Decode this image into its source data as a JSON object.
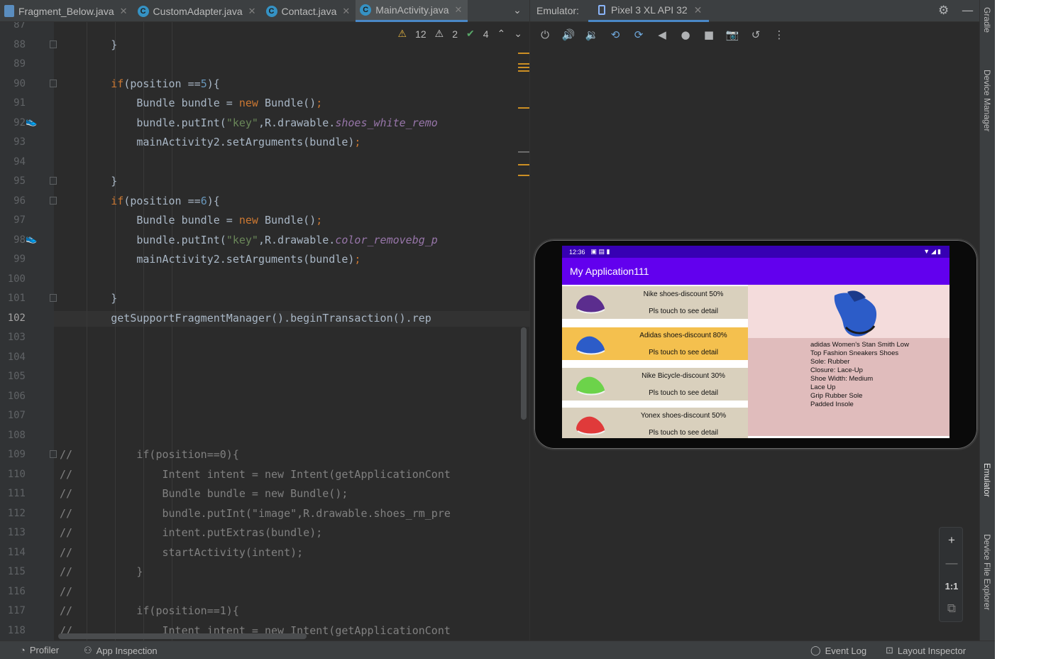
{
  "editor_tabs": [
    {
      "label": "Fragment_Below.java",
      "icon": "java-file-icon",
      "active": false
    },
    {
      "label": "CustomAdapter.java",
      "icon": "java-class-icon",
      "active": false
    },
    {
      "label": "Contact.java",
      "icon": "java-class-icon",
      "active": false
    },
    {
      "label": "MainActivity.java",
      "icon": "java-class-icon",
      "active": true
    }
  ],
  "inspections": {
    "warnings": "12",
    "weak_warnings": "2",
    "typos": "4"
  },
  "code_lines": [
    {
      "n": "87",
      "text": ""
    },
    {
      "n": "88",
      "text": "        }"
    },
    {
      "n": "89",
      "text": ""
    },
    {
      "n": "90",
      "text": "        if(position ==5){"
    },
    {
      "n": "91",
      "text": "            Bundle bundle = new Bundle();"
    },
    {
      "n": "92",
      "text": "            bundle.putInt(\"key\",R.drawable.shoes_white_remo"
    },
    {
      "n": "93",
      "text": "            mainActivity2.setArguments(bundle);"
    },
    {
      "n": "94",
      "text": ""
    },
    {
      "n": "95",
      "text": "        }"
    },
    {
      "n": "96",
      "text": "        if(position ==6){"
    },
    {
      "n": "97",
      "text": "            Bundle bundle = new Bundle();"
    },
    {
      "n": "98",
      "text": "            bundle.putInt(\"key\",R.drawable.color_removebg_p"
    },
    {
      "n": "99",
      "text": "            mainActivity2.setArguments(bundle);"
    },
    {
      "n": "100",
      "text": ""
    },
    {
      "n": "101",
      "text": "        }"
    },
    {
      "n": "102",
      "text": "        getSupportFragmentManager().beginTransaction().rep"
    },
    {
      "n": "103",
      "text": ""
    },
    {
      "n": "104",
      "text": ""
    },
    {
      "n": "105",
      "text": ""
    },
    {
      "n": "106",
      "text": ""
    },
    {
      "n": "107",
      "text": ""
    },
    {
      "n": "108",
      "text": ""
    },
    {
      "n": "109",
      "text": "//          if(position==0){"
    },
    {
      "n": "110",
      "text": "//              Intent intent = new Intent(getApplicationCont"
    },
    {
      "n": "111",
      "text": "//              Bundle bundle = new Bundle();"
    },
    {
      "n": "112",
      "text": "//              bundle.putInt(\"image\",R.drawable.shoes_rm_pre"
    },
    {
      "n": "113",
      "text": "//              intent.putExtras(bundle);"
    },
    {
      "n": "114",
      "text": "//              startActivity(intent);"
    },
    {
      "n": "115",
      "text": "//          }"
    },
    {
      "n": "116",
      "text": "//"
    },
    {
      "n": "117",
      "text": "//          if(position==1){"
    },
    {
      "n": "118",
      "text": "//              Intent intent = new Intent(getApplicationCont"
    }
  ],
  "current_line": "102",
  "emulator": {
    "label": "Emulator:",
    "device_tab": "Pixel 3 XL API 32",
    "toolbar_icons": [
      "power-icon",
      "volume-up-icon",
      "volume-down-icon",
      "rotate-left-icon",
      "rotate-right-icon",
      "back-icon",
      "home-icon",
      "overview-icon",
      "screenshot-icon",
      "snapshot-icon",
      "more-icon"
    ]
  },
  "phone": {
    "time": "12:36",
    "app_title": "My Application111",
    "rows": [
      {
        "title": "Nike shoes-discount 50%",
        "subtitle": "Pls touch to see detail",
        "bg": "#d9d0bd",
        "shoe_color": "#5b2d8e"
      },
      {
        "title": "Adidas shoes-discount 80%",
        "subtitle": "Pls touch to see detail",
        "bg": "#f4c04e",
        "shoe_color": "#2c5cc8"
      },
      {
        "title": "Nike Bicycle-discount 30%",
        "subtitle": "Pls touch to see detail",
        "bg": "#d9d0bd",
        "shoe_color": "#6cd34a"
      },
      {
        "title": "Yonex shoes-discount 50%",
        "subtitle": "Pls touch to see detail",
        "bg": "#d9d0bd",
        "shoe_color": "#e03a3a"
      }
    ],
    "detail_lines": [
      "adidas Women's Stan Smith Low",
      "Top Fashion Sneakers Shoes",
      "Sole: Rubber",
      "Closure: Lace-Up",
      "Shoe Width: Medium",
      "Lace Up",
      "Grip Rubber Sole",
      "Padded Insole"
    ]
  },
  "zoom": {
    "plus": "+",
    "minus": "—",
    "one_to_one": "1:1"
  },
  "right_strip": [
    "Gradle",
    "Device Manager",
    "Emulator",
    "Device File Explorer"
  ],
  "bottom_bar": {
    "profiler": "Profiler",
    "app_inspection": "App Inspection",
    "event_log": "Event Log",
    "layout_inspector": "Layout Inspector"
  },
  "colors": {
    "accent": "#4a88c7",
    "app_primary": "#6200ee",
    "status_bar": "#3700b3"
  }
}
